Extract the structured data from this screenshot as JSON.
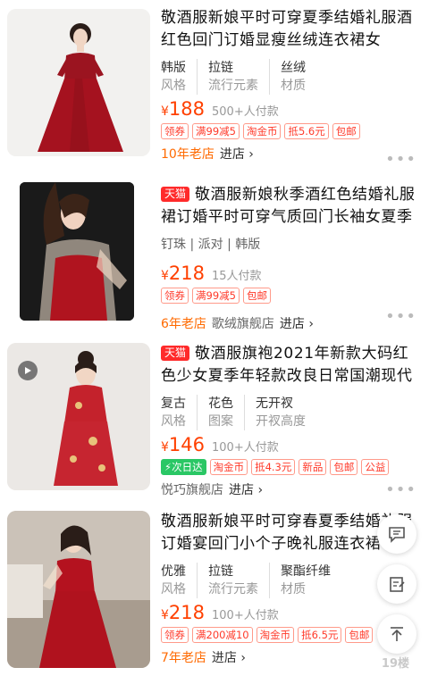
{
  "products": [
    {
      "title": "敬酒服新娘平时可穿夏季结婚礼服酒红色回门订婚显瘦丝绒连衣裙女",
      "tmall": "",
      "attrs": [
        {
          "v": "韩版",
          "k": "风格"
        },
        {
          "v": "拉链",
          "k": "流行元素"
        },
        {
          "v": "丝绒",
          "k": "材质"
        }
      ],
      "tags_line": "",
      "yen": "¥",
      "price": "188",
      "sold": "500+人付款",
      "coupons": [
        "领券",
        "满99减5",
        "淘金币",
        "抵5.6元",
        "包邮"
      ],
      "years": "10年老店",
      "shop": "",
      "enter": "进店 ›"
    },
    {
      "title": "敬酒服新娘秋季酒红色结婚礼服裙订婚平时可穿气质回门长袖女夏季",
      "tmall": "天猫",
      "attrs": [],
      "tags_line": "钉珠 | 派对 | 韩版",
      "yen": "¥",
      "price": "218",
      "sold": "15人付款",
      "coupons": [
        "领券",
        "满99减5",
        "包邮"
      ],
      "years": "6年老店",
      "shop": "歌绒旗舰店",
      "enter": "进店 ›"
    },
    {
      "title": "敬酒服旗袍2021年新款大码红色少女夏季年轻款改良日常国潮现代风",
      "tmall": "天猫",
      "attrs": [
        {
          "v": "复古",
          "k": "风格"
        },
        {
          "v": "花色",
          "k": "图案"
        },
        {
          "v": "无开衩",
          "k": "开衩高度"
        }
      ],
      "tags_line": "",
      "yen": "¥",
      "price": "146",
      "sold": "100+人付款",
      "coupons": [
        "⚡次日达",
        "淘金币",
        "抵4.3元",
        "新品",
        "包邮",
        "公益"
      ],
      "years": "",
      "shop": "悦巧旗舰店",
      "enter": "进店 ›"
    },
    {
      "title": "敬酒服新娘平时可穿春夏季结婚礼服订婚宴回门小个子晚礼服连衣裙",
      "tmall": "",
      "attrs": [
        {
          "v": "优雅",
          "k": "风格"
        },
        {
          "v": "拉链",
          "k": "流行元素"
        },
        {
          "v": "聚酯纤维",
          "k": "材质"
        }
      ],
      "tags_line": "",
      "yen": "¥",
      "price": "218",
      "sold": "100+人付款",
      "coupons": [
        "领券",
        "满200减10",
        "淘金币",
        "抵6.5元",
        "包邮"
      ],
      "years": "7年老店",
      "shop": "",
      "enter": "进店 ›"
    }
  ],
  "more_label": "•••",
  "watermark": "19楼",
  "icons": {
    "chat": "chat-bubble-icon",
    "edit": "edit-note-icon",
    "top": "back-to-top-icon",
    "play": "play-icon"
  },
  "colors": {
    "price": "#ff4000",
    "tmall": "#ff2a2a",
    "years": "#ff6a00",
    "coupon": "#ff3a2a",
    "next_day": "#2ac765"
  }
}
